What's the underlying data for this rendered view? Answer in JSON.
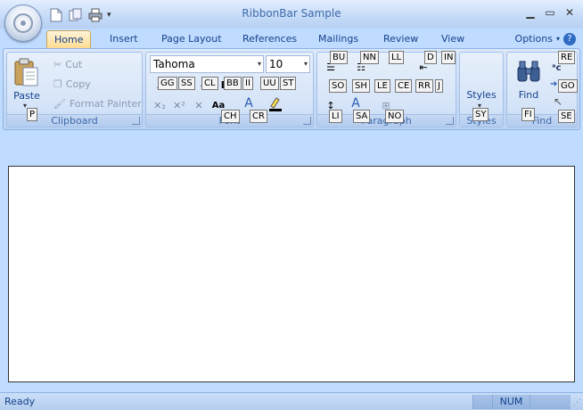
{
  "window": {
    "title": "RibbonBar Sample"
  },
  "tabs": [
    {
      "label": "Home"
    },
    {
      "label": "Insert"
    },
    {
      "label": "Page Layout"
    },
    {
      "label": "References"
    },
    {
      "label": "Mailings"
    },
    {
      "label": "Review"
    },
    {
      "label": "View"
    }
  ],
  "options_label": "Options",
  "clipboard": {
    "paste": "Paste",
    "cut": "Cut",
    "copy": "Copy",
    "format_painter": "Format Painter",
    "group_label": "Clipboard"
  },
  "font": {
    "family": "Tahoma",
    "size": "10",
    "group_label": "Font"
  },
  "paragraph": {
    "group_label": "Paragraph"
  },
  "styles": {
    "label": "Styles",
    "group_label": "Styles"
  },
  "find": {
    "label": "Find",
    "group_label": "Find"
  },
  "keytips": {
    "paste": "P",
    "bu": "BU",
    "nn": "NN",
    "ll": "LL",
    "d": "D",
    "in": "IN",
    "re": "RE",
    "gg": "GG",
    "ss": "SS",
    "cl": "CL",
    "bb": "BB",
    "ii": "II",
    "uu": "UU",
    "st": "ST",
    "so": "SO",
    "sh": "SH",
    "le": "LE",
    "ce": "CE",
    "rr": "RR",
    "j": "J",
    "go": "GO",
    "ch": "CH",
    "cr": "CR",
    "li": "LI",
    "sa": "SA",
    "no": "NO",
    "sy": "SY",
    "fi": "FI",
    "se": "SE"
  },
  "status": {
    "text": "Ready",
    "num": "NUM"
  }
}
